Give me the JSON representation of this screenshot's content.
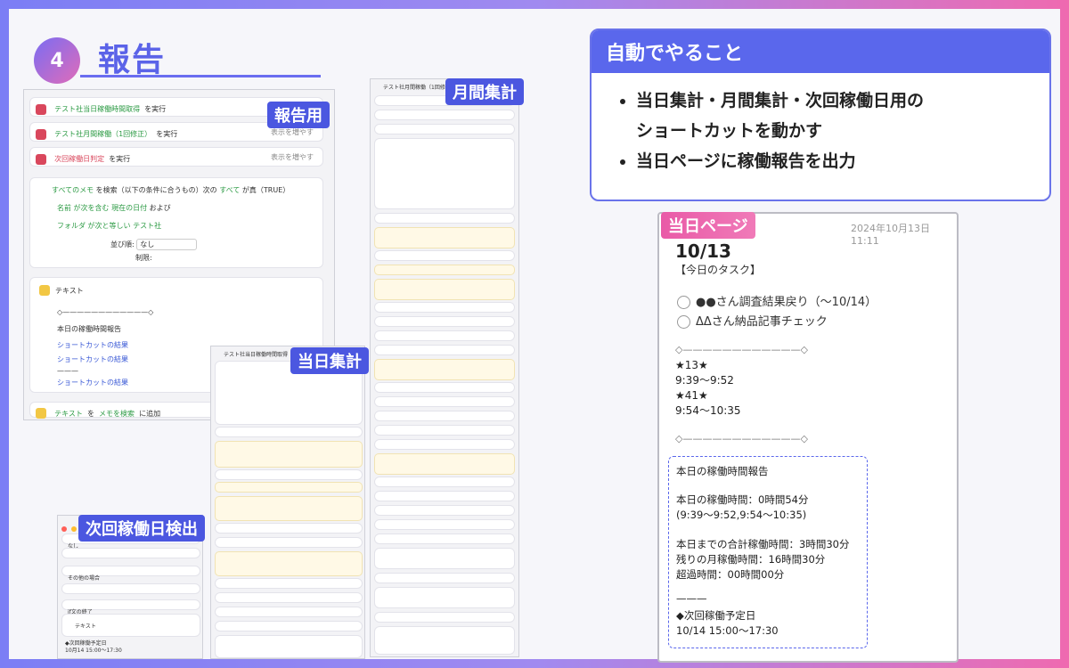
{
  "header": {
    "step_number": "4",
    "title": "報告"
  },
  "labels": {
    "houkoku": "報告用",
    "getsukan": "月間集計",
    "toujitsu": "当日集計",
    "jikai": "次回稼働日検出",
    "toujitsu_page": "当日ページ"
  },
  "main_screen": {
    "rows": [
      {
        "text": "テスト社当日稼働時間取得",
        "suffix": "を実行"
      },
      {
        "text": "テスト社月間稼働（1回修正）",
        "suffix": "を実行",
        "more": "表示を増やす"
      },
      {
        "text": "次回稼働日判定",
        "suffix": "を実行",
        "more": "表示を増やす"
      }
    ],
    "filter": {
      "line1_a": "すべてのメモ",
      "line1_b": "を検索（以下の条件に合うもの）次の",
      "line1_c": "すべて",
      "line1_d": "が真（TRUE）",
      "cond1_a": "名前",
      "cond1_b": "が次を含む",
      "cond1_c": "現在の日付",
      "cond1_d": "および",
      "cond2_a": "フォルダ",
      "cond2_b": "が次と等しい",
      "cond2_c": "テスト社",
      "sort_label": "並び順:",
      "sort_value": "なし",
      "limit_label": "制限:"
    },
    "text_block": {
      "title": "テキスト",
      "line": "◇————————————◇",
      "report_title": "本日の稼働時間報告",
      "item1": "ショートカットの結果",
      "item2": "ショートカットの結果",
      "dash": "———",
      "item3": "ショートカットの結果"
    },
    "bottom": {
      "a": "テキスト",
      "b": "を",
      "c": "メモを検索",
      "d": "に追加"
    }
  },
  "shots": {
    "getsukan_header": "テスト社月間稼働（1回修正）",
    "toujitsu_header": "テスト社当日稼働時間取得",
    "jikai_rows": [
      "なし",
      "次の値",
      "その他の場合",
      "if文の終了",
      "テキスト",
      "◆次回稼働予定日",
      "10月14 15:00〜17:30"
    ]
  },
  "right_box": {
    "title": "自動でやること",
    "items": [
      "当日集計・月間集計・次回稼働日用の",
      "ショートカットを動かす",
      "当日ページに稼働報告を出力"
    ]
  },
  "page": {
    "timestamp": "2024年10月13日 11:11",
    "title": "10/13",
    "subtitle": "【今日のタスク】",
    "task1": "●●さん調査結果戻り（〜10/14）",
    "task2": "ΔΔさん納品記事チェック",
    "divider": "◇————————————◇",
    "e1": "★13★",
    "e1_time": "9:39〜9:52",
    "e2": "★41★",
    "e2_time": "9:54〜10:35",
    "divider2": "◇————————————◇",
    "report": {
      "r1": "本日の稼働時間報告",
      "r2": "本日の稼働時間：0時間54分",
      "r3": "(9:39〜9:52,9:54〜10:35)",
      "r4": "本日までの合計稼働時間：3時間30分",
      "r5": "残りの月稼働時間：16時間30分",
      "r6": "超過時間：00時間00分",
      "r7": "———",
      "r8": "◆次回稼働予定日",
      "r9": "10/14 15:00〜17:30"
    }
  }
}
